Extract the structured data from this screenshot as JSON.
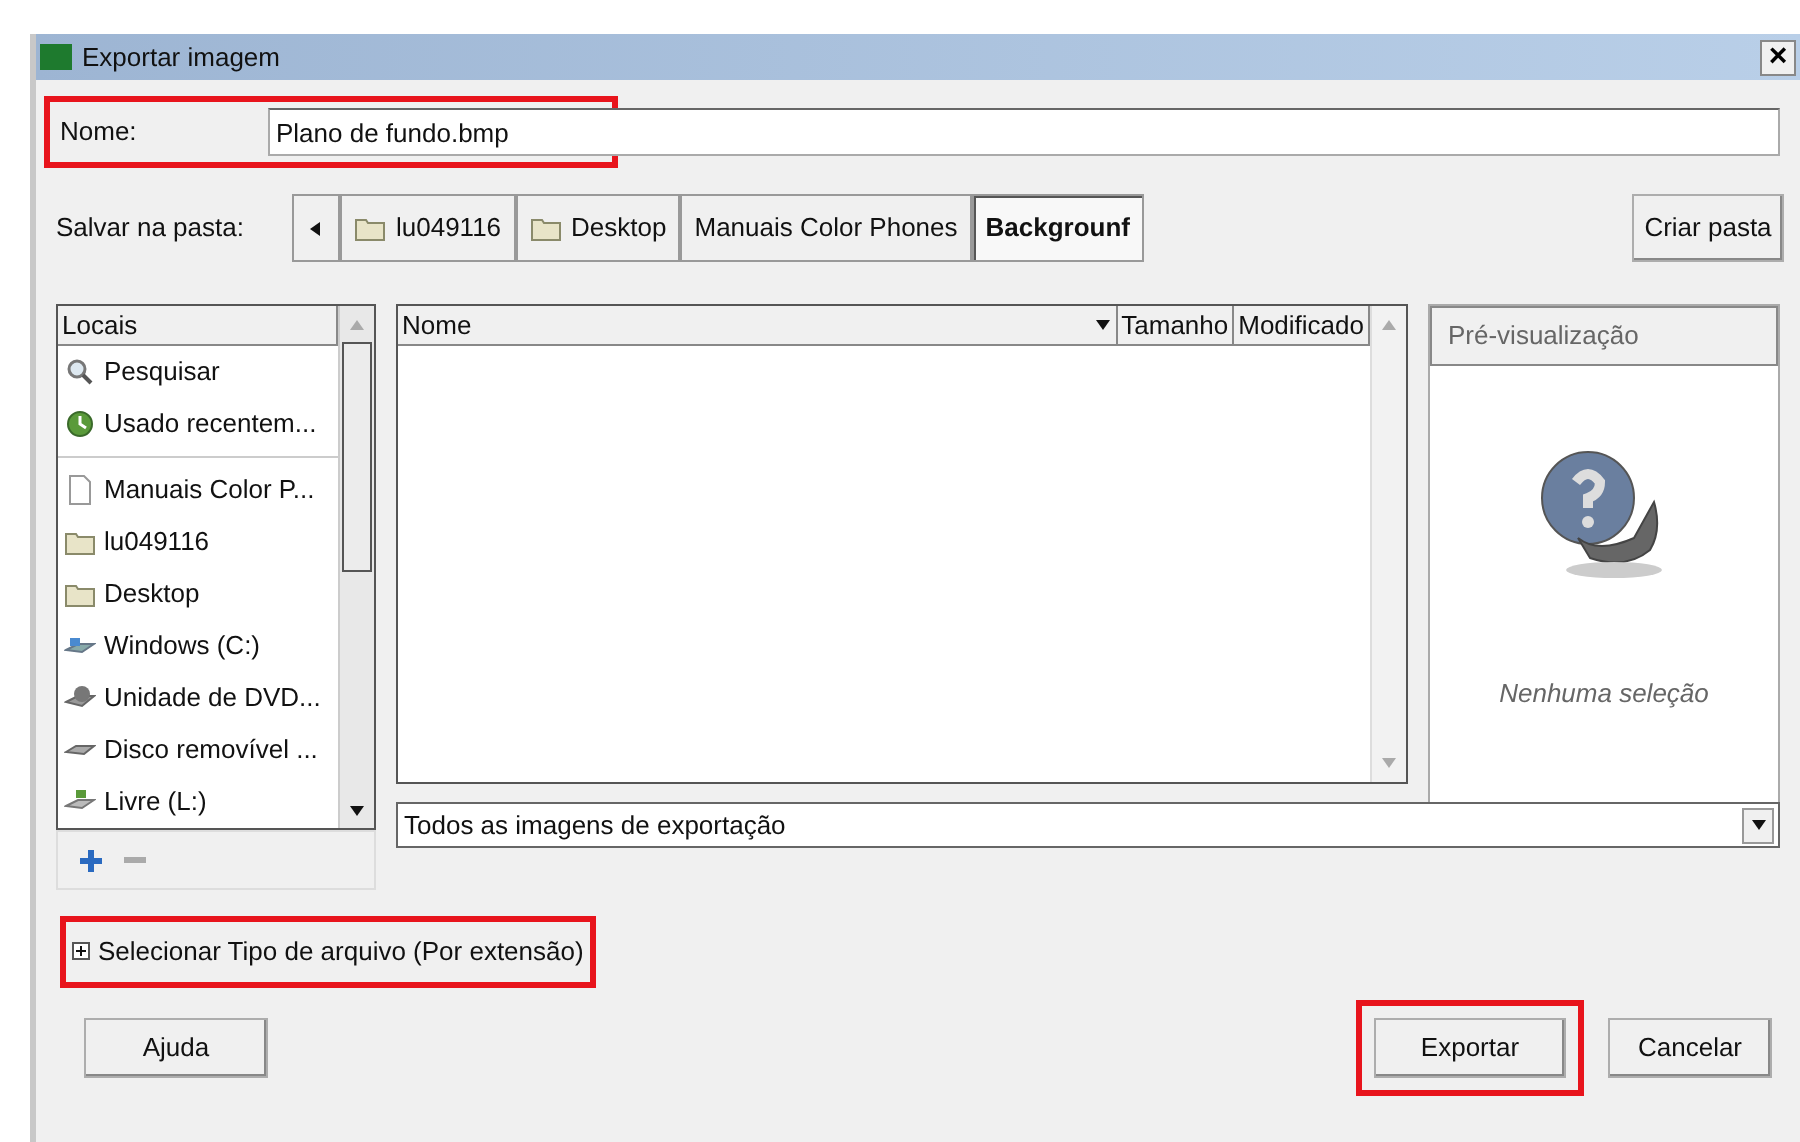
{
  "window": {
    "title": "Exportar imagem",
    "close": "×"
  },
  "name_field": {
    "label": "Nome:",
    "value": "Plano de fundo.bmp",
    "highlighted": true
  },
  "path_bar": {
    "label": "Salvar na pasta:",
    "crumbs": [
      {
        "label": "lu049116",
        "kind": "folder",
        "selected": false
      },
      {
        "label": "Desktop",
        "kind": "folder",
        "selected": false
      },
      {
        "label": "Manuais Color Phones",
        "kind": "plain",
        "selected": false
      },
      {
        "label": "Backgrounf",
        "kind": "plain",
        "selected": true
      }
    ]
  },
  "create_folder": "Criar pasta",
  "places": {
    "header": "Locais",
    "groups": [
      [
        {
          "label": "Pesquisar",
          "kind": "search"
        },
        {
          "label": "Usado recentem...",
          "kind": "recent"
        }
      ],
      [
        {
          "label": "Manuais Color P...",
          "kind": "document"
        },
        {
          "label": "lu049116",
          "kind": "folder"
        },
        {
          "label": "Desktop",
          "kind": "folder"
        },
        {
          "label": "Windows (C:)",
          "kind": "drive"
        },
        {
          "label": "Unidade de DVD...",
          "kind": "dvd"
        },
        {
          "label": "Disco removível ...",
          "kind": "removable"
        },
        {
          "label": "Livre (L:)",
          "kind": "network"
        }
      ]
    ]
  },
  "files": {
    "columns": [
      "Nome",
      "Tamanho",
      "Modificado"
    ]
  },
  "preview": {
    "header": "Pré-visualização",
    "message": "Nenhuma seleção"
  },
  "filter": {
    "value": "Todos as imagens de exportação"
  },
  "file_type_expander": {
    "label": "Selecionar Tipo de arquivo (Por extensão)",
    "expanded": false,
    "highlighted": true
  },
  "buttons": [
    {
      "label": "Ajuda",
      "highlighted": false
    },
    {
      "label": "Exportar",
      "highlighted": true
    },
    {
      "label": "Cancelar",
      "highlighted": false
    }
  ]
}
